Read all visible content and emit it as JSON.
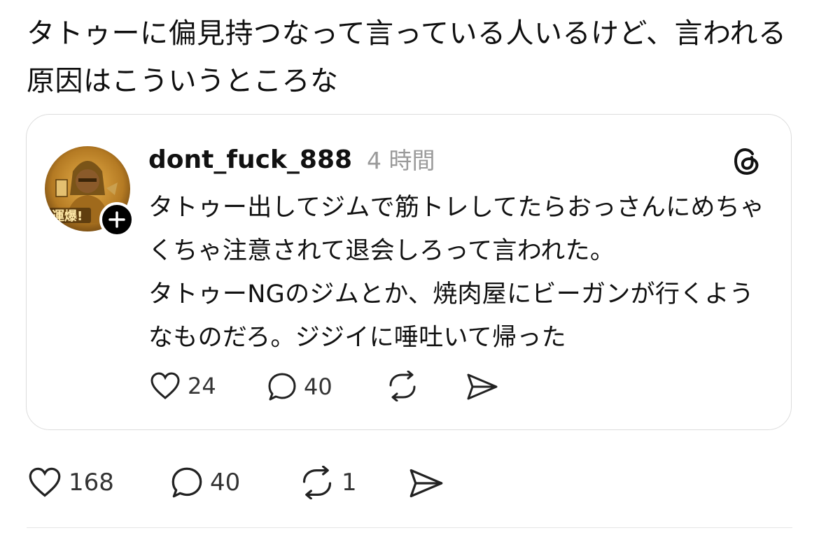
{
  "post": {
    "text": "タトゥーに偏見持つなって言っている人いるけど、言われる原因はこういうところな"
  },
  "quoted_post": {
    "username": "dont_fuck_888",
    "timestamp": "4 時間",
    "paragraph1": "タトゥー出してジムで筋トレしてたらおっさんにめちゃくちゃ注意されて退会しろって言われた。",
    "paragraph2": "タトゥーNGのジムとか、焼肉屋にビーガンが行くようなものだろ。ジジイに唾吐いて帰った",
    "avatar_text": "運爆",
    "counts": {
      "likes": "24",
      "replies": "40"
    }
  },
  "post_actions": {
    "likes": "168",
    "replies": "40",
    "reposts": "1"
  },
  "icons": {
    "like": "heart-icon",
    "reply": "speech-bubble-icon",
    "repost": "repost-arrows-icon",
    "share": "paper-plane-icon",
    "platform": "threads-logo-icon",
    "follow": "plus-icon"
  },
  "colors": {
    "text": "#111111",
    "muted": "#9a9a9a",
    "border": "#dcdcdc",
    "avatar_gold": "#c08a2e"
  }
}
